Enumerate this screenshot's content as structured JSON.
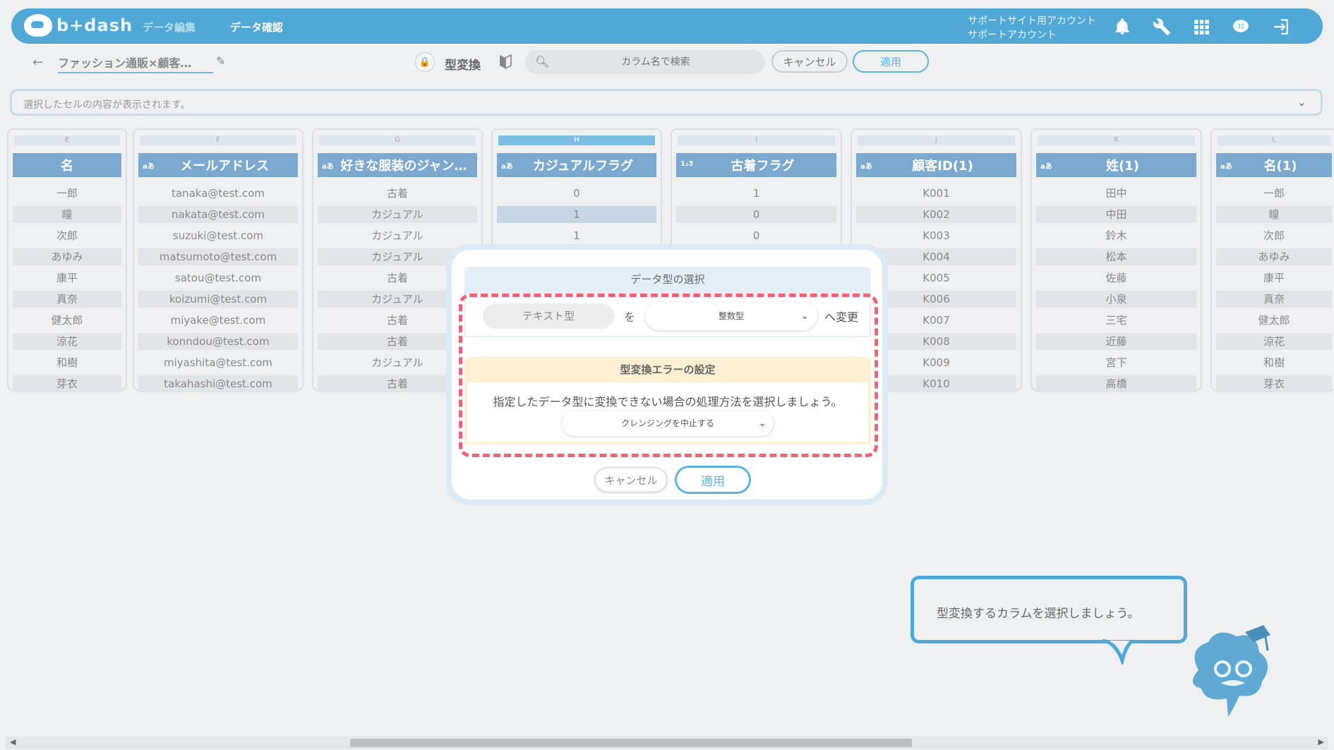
{
  "header": {
    "logo_text": "b+dash",
    "nav_edit": "データ編集",
    "nav_confirm": "データ確認",
    "account_line1": "サポートサイト用アカウント",
    "account_line2": "サポートアカウント",
    "icons": [
      "bell-icon",
      "wrench-icon",
      "grid-icon",
      "brain-badge-icon",
      "logout-icon"
    ],
    "badge_count": "32"
  },
  "toolbar": {
    "back": "←",
    "filename": "ファッション通販×顧客…",
    "mode_label": "型変換",
    "search_placeholder": "カラム名で検索",
    "cancel_label": "キャンセル",
    "apply_label": "適用"
  },
  "cellbar": {
    "placeholder": "選択したセルの内容が表示されます。"
  },
  "columns": [
    {
      "letter": "E",
      "type": "",
      "name": "名",
      "cells": [
        "一郎",
        "瞳",
        "次郎",
        "あゆみ",
        "康平",
        "真奈",
        "健太郎",
        "涼花",
        "和樹",
        "芽衣"
      ]
    },
    {
      "letter": "F",
      "type": "aあ",
      "name": "メールアドレス",
      "cells": [
        "tanaka@test.com",
        "nakata@test.com",
        "suzuki@test.com",
        "matsumoto@test.com",
        "satou@test.com",
        "koizumi@test.com",
        "miyake@test.com",
        "konndou@test.com",
        "miyashita@test.com",
        "takahashi@test.com"
      ]
    },
    {
      "letter": "G",
      "type": "aあ",
      "name": "好きな服装のジャン…",
      "cells": [
        "古着",
        "カジュアル",
        "カジュアル",
        "カジュアル",
        "古着",
        "カジュアル",
        "古着",
        "古着",
        "カジュアル",
        "古着"
      ]
    },
    {
      "letter": "H",
      "type": "aあ",
      "name": "カジュアルフラグ",
      "cells": [
        "0",
        "1",
        "1",
        "",
        "",
        "",
        "",
        "",
        "",
        ""
      ],
      "selected": true
    },
    {
      "letter": "I",
      "type": "1₂3",
      "name": "古着フラグ",
      "cells": [
        "1",
        "0",
        "0",
        "",
        "",
        "",
        "",
        "",
        "",
        ""
      ]
    },
    {
      "letter": "J",
      "type": "aあ",
      "name": "顧客ID(1)",
      "cells": [
        "K001",
        "K002",
        "K003",
        "K004",
        "K005",
        "K006",
        "K007",
        "K008",
        "K009",
        "K010"
      ]
    },
    {
      "letter": "K",
      "type": "aあ",
      "name": "姓(1)",
      "cells": [
        "田中",
        "中田",
        "鈴木",
        "松本",
        "佐藤",
        "小泉",
        "三宅",
        "近藤",
        "宮下",
        "高橋"
      ]
    },
    {
      "letter": "L",
      "type": "aあ",
      "name": "名(1)",
      "cells": [
        "一郎",
        "瞳",
        "次郎",
        "あゆみ",
        "康平",
        "真奈",
        "健太郎",
        "涼花",
        "和樹",
        "芽衣"
      ]
    }
  ],
  "modal": {
    "section1_title": "データ型の選択",
    "from_type": "テキスト型",
    "particle_wo": "を",
    "to_type": "整数型",
    "to_change": "へ変更",
    "section2_title": "型変換エラーの設定",
    "error_description": "指定したデータ型に変換できない場合の処理方法を選択しましょう。",
    "error_option": "クレンジングを中止する",
    "cancel_label": "キャンセル",
    "apply_label": "適用"
  },
  "hint": {
    "bubble_text": "型変換するカラムを選択しましょう。"
  },
  "colors": {
    "brand": "#4fa8d6",
    "header_blue": "#7ca9cf",
    "highlight_dash": "#f16374",
    "warning_bg": "#fdf0d3"
  }
}
